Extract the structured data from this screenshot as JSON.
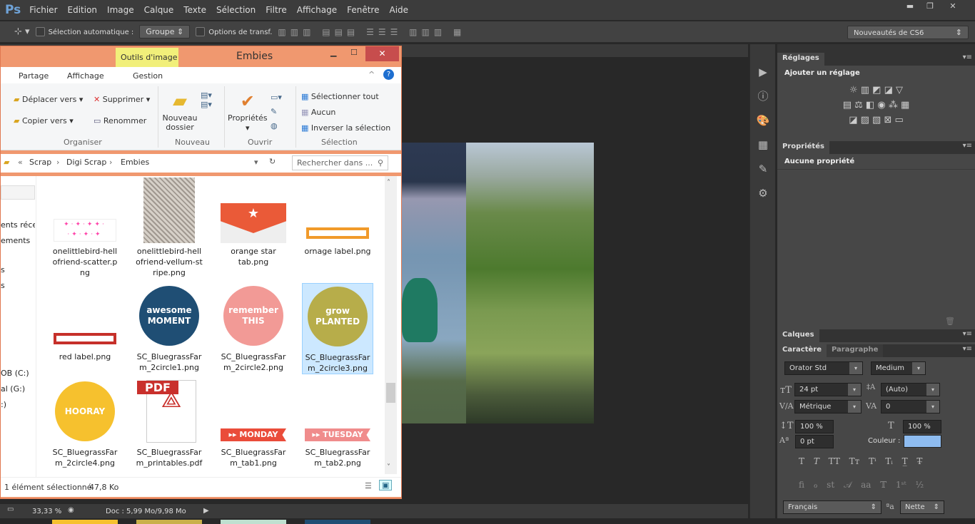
{
  "app": {
    "logo": "Ps",
    "menu": [
      "Fichier",
      "Edition",
      "Image",
      "Calque",
      "Texte",
      "Sélection",
      "Filtre",
      "Affichage",
      "Fenêtre",
      "Aide"
    ]
  },
  "options": {
    "auto_select": "Sélection automatique :",
    "group": "Groupe",
    "transform": "Options de transf.",
    "preset": "Nouveautés de CS6"
  },
  "panels": {
    "reglages_tab": "Réglages",
    "reglages_title": "Ajouter un réglage",
    "proprietes_tab": "Propriétés",
    "proprietes_title": "Aucune propriété",
    "calques_tab": "Calques",
    "caractere_tab": "Caractère",
    "paragraphe_tab": "Paragraphe",
    "font": "Orator Std",
    "style": "Medium",
    "size": "24 pt",
    "leading": "(Auto)",
    "kerning": "Métrique",
    "tracking": "0",
    "vscale": "100 %",
    "hscale": "100 %",
    "baseline": "0 pt",
    "color_label": "Couleur :",
    "color": "#8ebcf0",
    "language": "Français",
    "antialias": "Nette"
  },
  "status": {
    "zoom": "33,33 %",
    "doc": "Doc : 5,99 Mo/9,98 Mo"
  },
  "explorer": {
    "title": "Embies",
    "tools_tab": "Outils d'image",
    "tabs": [
      "Partage",
      "Affichage",
      "Gestion"
    ],
    "ribbon": {
      "move": "Déplacer vers",
      "copy": "Copier vers",
      "delete": "Supprimer",
      "rename": "Renommer",
      "organize": "Organiser",
      "new_folder": "Nouveau dossier",
      "new": "Nouveau",
      "properties": "Propriétés",
      "open": "Ouvrir",
      "select_all": "Sélectionner tout",
      "none": "Aucun",
      "invert": "Inverser la sélection",
      "selection": "Sélection"
    },
    "breadcrumb": [
      "Scrap",
      "Digi Scrap",
      "Embies"
    ],
    "search_placeholder": "Rechercher dans ...",
    "nav": [
      "ents récen",
      "ements",
      "s",
      "s",
      "OB (C:)",
      "al (G:)",
      ":)"
    ],
    "files": [
      {
        "name": "onelittlebird-helloffriend-scatter.png",
        "label": "onelittlebird-hell ofriend-scatter.p ng"
      },
      {
        "name": "onelittlebird-hellofriend-vellum-stripe.png",
        "label": "onelittlebird-hell ofriend-vellum-st ripe.png"
      },
      {
        "name": "orange star tab.png",
        "label": "orange star tab.png"
      },
      {
        "name": "ornage label.png",
        "label": "ornage label.png"
      },
      {
        "name": "red label.png",
        "label": "red label.png"
      },
      {
        "name": "SC_BluegrassFarm_2circle1.png",
        "label": "SC_BluegrassFar m_2circle1.png",
        "text": "awesome MOMENT"
      },
      {
        "name": "SC_BluegrassFarm_2circle2.png",
        "label": "SC_BluegrassFar m_2circle2.png",
        "text": "remember THIS"
      },
      {
        "name": "SC_BluegrassFarm_2circle3.png",
        "label": "SC_BluegrassFar m_2circle3.png",
        "text": "grow PLANTED"
      },
      {
        "name": "SC_BluegrassFarm_2circle4.png",
        "label": "SC_BluegrassFar m_2circle4.png",
        "text": "HOORAY"
      },
      {
        "name": "SC_BluegrassFarm_printables.pdf",
        "label": "SC_BluegrassFar m_printables.pdf",
        "text": "PDF"
      },
      {
        "name": "SC_BluegrassFarm_tab1.png",
        "label": "SC_BluegrassFar m_tab1.png",
        "text": "MONDAY"
      },
      {
        "name": "SC_BluegrassFarm_tab2.png",
        "label": "SC_BluegrassFar m_tab2.png",
        "text": "TUESDAY"
      }
    ],
    "status_count": "1 élément sélectionné",
    "status_size": "47,8 Ko"
  }
}
